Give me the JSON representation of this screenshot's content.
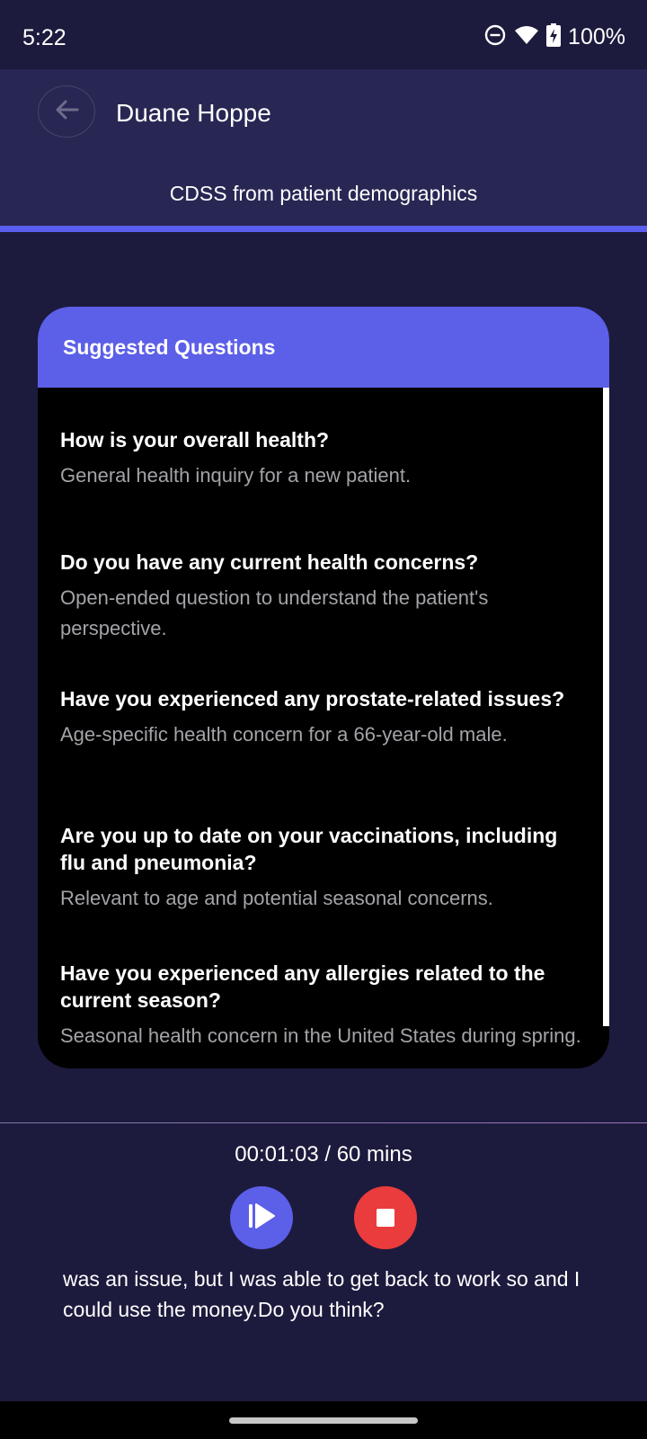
{
  "status_bar": {
    "time": "5:22",
    "battery": "100%",
    "icons": [
      "do-not-disturb-icon",
      "wifi-icon",
      "battery-charging-icon"
    ]
  },
  "header": {
    "back_icon": "arrow-left-icon",
    "patient_name": "Duane Hoppe",
    "subtitle": "CDSS from patient demographics"
  },
  "card": {
    "title": "Suggested Questions",
    "questions": [
      {
        "question": "How is your overall health?",
        "rationale": "General health inquiry for a new patient."
      },
      {
        "question": "Do you have any current health concerns?",
        "rationale": "Open-ended question to understand the patient's perspective."
      },
      {
        "question": "Have you experienced any prostate-related issues?",
        "rationale": "Age-specific health concern for a 66-year-old male."
      },
      {
        "question": "Are you up to date on your vaccinations, including flu and pneumonia?",
        "rationale": "Relevant to age and potential seasonal concerns."
      },
      {
        "question": "Have you experienced any allergies related to the current season?",
        "rationale": "Seasonal health concern in the United States during spring."
      }
    ]
  },
  "recorder": {
    "timer": "00:01:03 / 60 mins",
    "play_icon": "resume-icon",
    "stop_icon": "stop-icon",
    "transcript": "was an issue, but I was able to get back to work so and I could use the money.Do you think?"
  },
  "colors": {
    "background": "#1c1b3d",
    "header": "#282754",
    "accent": "#5c5fe8",
    "stop": "#ea3c3c"
  }
}
